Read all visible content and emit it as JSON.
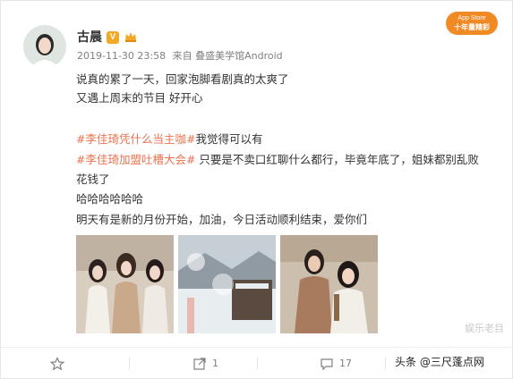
{
  "user": {
    "name": "古晨",
    "verified_badge": "V"
  },
  "app_badge": {
    "line1": "App Store",
    "line2": "十年量精彩"
  },
  "meta": {
    "datetime": "2019-11-30 23:58",
    "from_label": "来自",
    "source": "叠盛美学馆Android"
  },
  "post": {
    "line1": "说真的累了一天，回家泡脚看剧真的太爽了",
    "line2": "又遇上周末的节目 好开心",
    "tag1": "#李佳琦凭什么当主咖#",
    "line4_text": "我觉得可以有",
    "tag2": "#李佳琦加盟吐槽大会#",
    "line5_text": " 只要是不卖口红聊什么都行，毕竟年底了，姐妹都别乱败",
    "line6": "花钱了",
    "line7": "哈哈哈哈哈哈",
    "line8": "明天有是新的月份开始，加油，今日活动顺利结束，爱你们"
  },
  "actions": {
    "repost_count": "1",
    "like_count": "17"
  },
  "watermarks": {
    "right": "娱乐老目",
    "bottom": "头条 @三尺蓬点网"
  },
  "colors": {
    "hashtag": "#eb7350",
    "app_badge": "#f08a24",
    "verified": "#f5a623",
    "meta_text": "#808080"
  }
}
